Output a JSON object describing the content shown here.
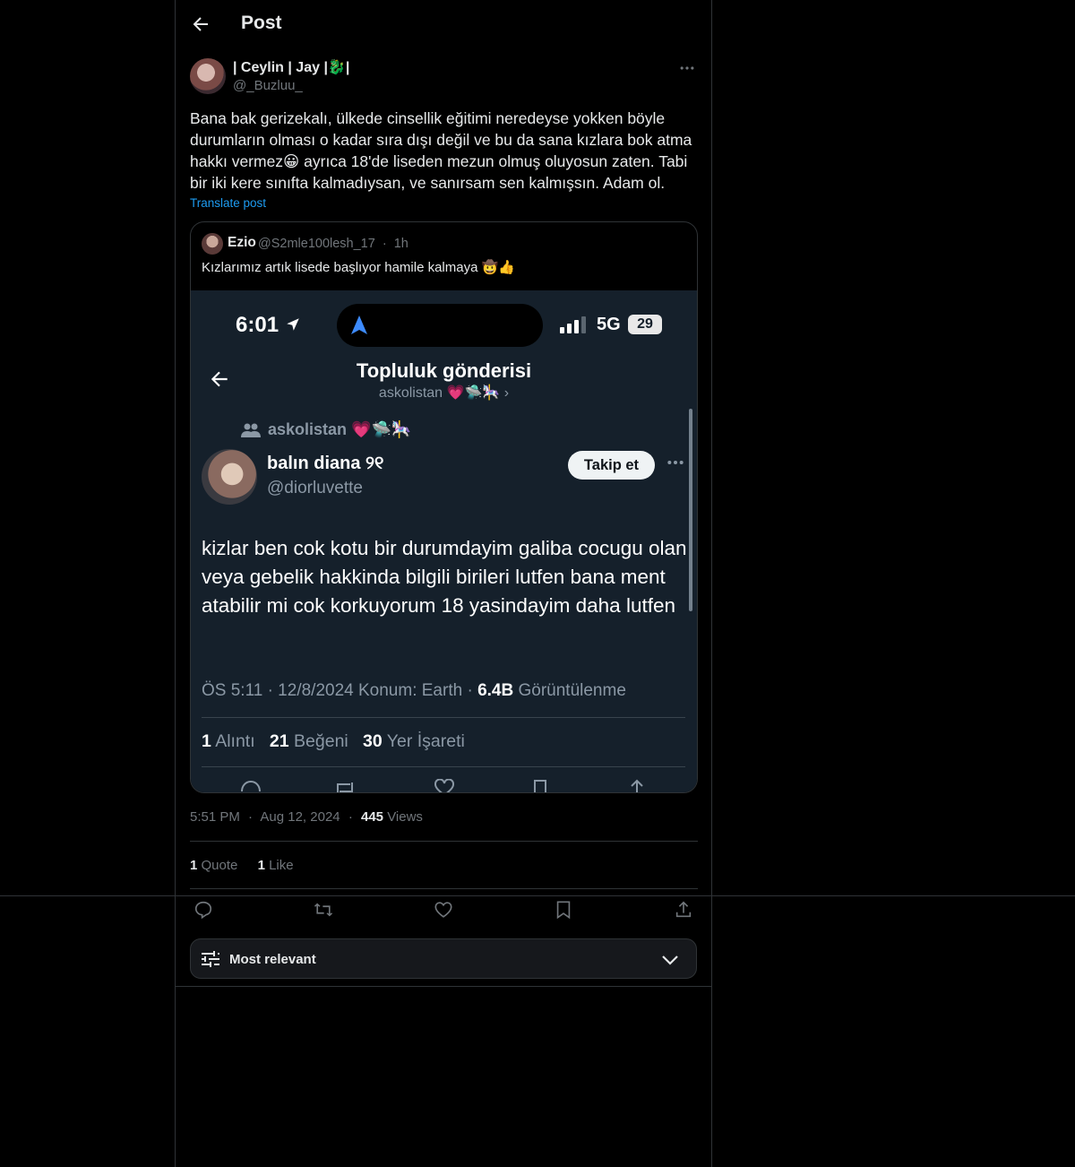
{
  "header": {
    "title": "Post"
  },
  "post": {
    "display_name": "| Ceylin | Jay |🐉|",
    "handle": "@_Buzluu_",
    "text": "Bana bak gerizekalı, ülkede cinsellik eğitimi neredeyse yokken böyle durumların olması o kadar sıra dışı değil ve bu da sana kızlara bok atma hakkı vermez😀 ayrıca 18'de liseden mezun olmuş oluyosun zaten. Tabi bir iki kere sınıfta kalmadıysan, ve sanırsam sen kalmışsın. Adam ol.",
    "translate_label": "Translate post",
    "time": "5:51 PM",
    "sep": "·",
    "date": "Aug 12, 2024",
    "views_count": "445",
    "views_label": "Views",
    "quote_count": "1",
    "quote_label": "Quote",
    "like_count": "1",
    "like_label": "Like"
  },
  "quoted": {
    "display_name": "Ezio",
    "handle": "@S2mle100lesh_17",
    "sep": "·",
    "age": "1h",
    "text": "Kızlarımız artık lisede başlıyor hamile kalmaya 🤠👍",
    "screenshot": {
      "status_time": "6:01",
      "network": "5G",
      "battery": "29",
      "title": "Topluluk gönderisi",
      "subtitle": "askolistan 💗🛸🎠 ›",
      "community": "askolistan 💗🛸🎠",
      "author_name": "balın diana ୨୧",
      "author_handle": "@diorluvette",
      "follow_label": "Takip et",
      "body": "kizlar ben cok kotu bir durumdayim galiba cocugu olan veya gebelik hakkinda bilgili birileri lutfen bana ment atabilir mi cok korkuyorum 18 yasindayim daha lutfen",
      "meta_time": "ÖS 5:11 · 12/8/2024 Konum: Earth ·",
      "meta_views_count": "6.4B",
      "meta_views_label": "Görüntülenme",
      "stat1_count": "1",
      "stat1_label": "Alıntı",
      "stat2_count": "21",
      "stat2_label": "Beğeni",
      "stat3_count": "30",
      "stat3_label": "Yer İşareti"
    }
  },
  "reply_sort": {
    "label": "Most relevant"
  },
  "colors": {
    "background": "#000000",
    "accent": "#1d9bf0",
    "border": "#2f3336",
    "muted": "#71767b",
    "screenshot_bg": "#15202b"
  }
}
